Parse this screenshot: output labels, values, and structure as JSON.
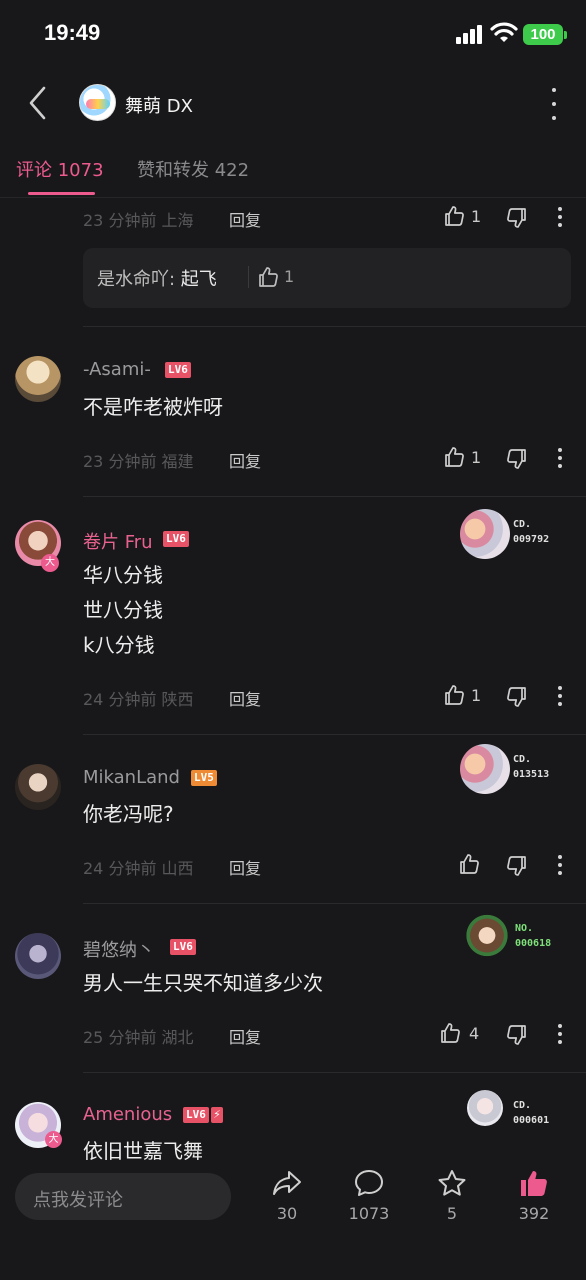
{
  "status_bar": {
    "time": "19:49",
    "battery": "100"
  },
  "header": {
    "title": "舞萌 DX"
  },
  "tabs": [
    {
      "label": "评论 1073",
      "active": true
    },
    {
      "label": "赞和转发 422",
      "active": false
    }
  ],
  "partial_comment": {
    "time_location": "23 分钟前  上海",
    "reply": "回复",
    "likes": "1",
    "sub_reply": {
      "user": "是水命吖",
      "text": "起飞",
      "likes": "1"
    }
  },
  "comments": [
    {
      "user": "-Asami-",
      "level": "LV6",
      "text": [
        "不是咋老被炸呀"
      ],
      "time_location": "23 分钟前  福建",
      "reply": "回复",
      "likes": "1"
    },
    {
      "user": "卷片 Fru",
      "level": "LV6",
      "text": [
        "华八分钱",
        "世八分钱",
        "k八分钱"
      ],
      "time_location": "24 分钟前  陕西",
      "reply": "回复",
      "likes": "1",
      "card_no": [
        "CD.",
        "009792"
      ]
    },
    {
      "user": "MikanLand",
      "level": "LV5",
      "text": [
        "你老冯呢?"
      ],
      "time_location": "24 分钟前  山西",
      "reply": "回复",
      "likes": "",
      "card_no": [
        "CD.",
        "013513"
      ]
    },
    {
      "user": "碧悠纳丶",
      "level": "LV6",
      "text": [
        "男人一生只哭不知道多少次"
      ],
      "time_location": "25 分钟前  湖北",
      "reply": "回复",
      "likes": "4",
      "card_no": [
        "NO.",
        "000618"
      ]
    },
    {
      "user": "Amenious",
      "level": "LV6",
      "text": [
        "依旧世嘉飞舞"
      ],
      "card_no": [
        "CD.",
        "000601"
      ]
    }
  ],
  "bottom_bar": {
    "input_placeholder": "点我发评论",
    "share_count": "30",
    "comment_count": "1073",
    "favorite_count": "5",
    "like_count": "392"
  },
  "colors": {
    "accent": "#ec5a8e",
    "background": "#18181a",
    "lv6": "#e85266",
    "lv5": "#f08b35"
  }
}
